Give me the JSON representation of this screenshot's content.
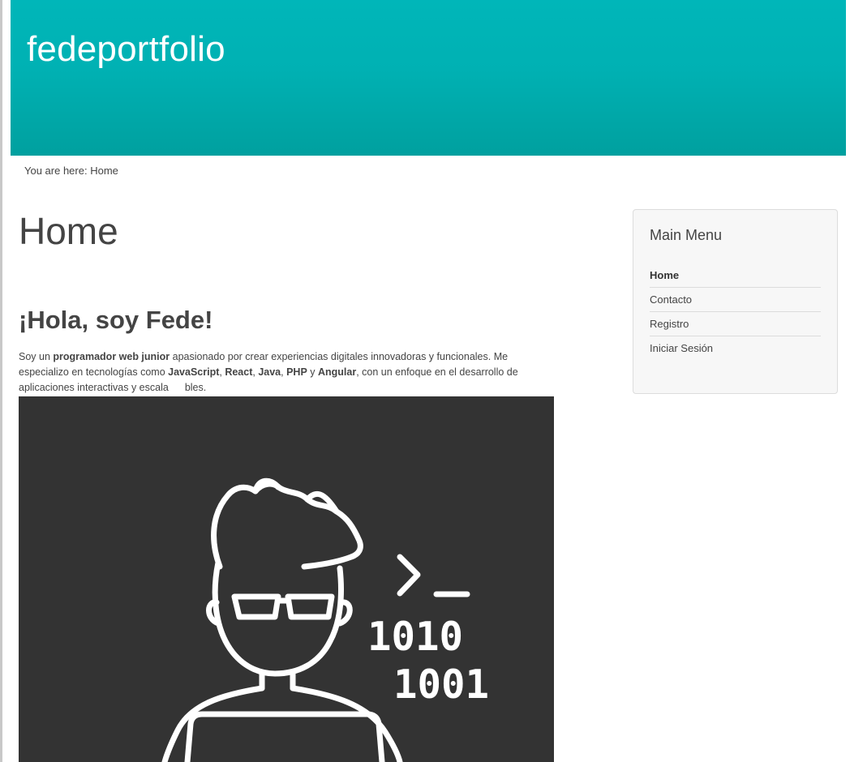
{
  "header": {
    "site_title": "fedeportfolio"
  },
  "breadcrumb": {
    "prefix": "You are here:",
    "current": "Home"
  },
  "page": {
    "title": "Home"
  },
  "intro": {
    "heading": "¡Hola, soy Fede!",
    "text": {
      "p1": "Soy un ",
      "b1": "programador web junior",
      "p2": " apasionado por crear experiencias digitales innovadoras y funcionales. Me especializo en tecnologías como ",
      "b2": "JavaScript",
      "p3": ", ",
      "b3": "React",
      "p4": ", ",
      "b4": "Java",
      "p5": ", ",
      "b5": "PHP",
      "p6": " y ",
      "b6": "Angular",
      "p7": ", con un enfoque en el desarrollo de aplicaciones interactivas y escala",
      "p8": "bles."
    }
  },
  "hero_image": {
    "prompt": ">_",
    "binary_line1": "1010",
    "binary_line2": "1001",
    "background": "#333333",
    "stroke": "#ffffff"
  },
  "sidebar": {
    "title": "Main Menu",
    "items": [
      {
        "label": "Home",
        "active": true
      },
      {
        "label": "Contacto",
        "active": false
      },
      {
        "label": "Registro",
        "active": false
      },
      {
        "label": "Iniciar Sesión",
        "active": false
      }
    ]
  },
  "colors": {
    "header": "#00b1b3",
    "text": "#444444"
  }
}
